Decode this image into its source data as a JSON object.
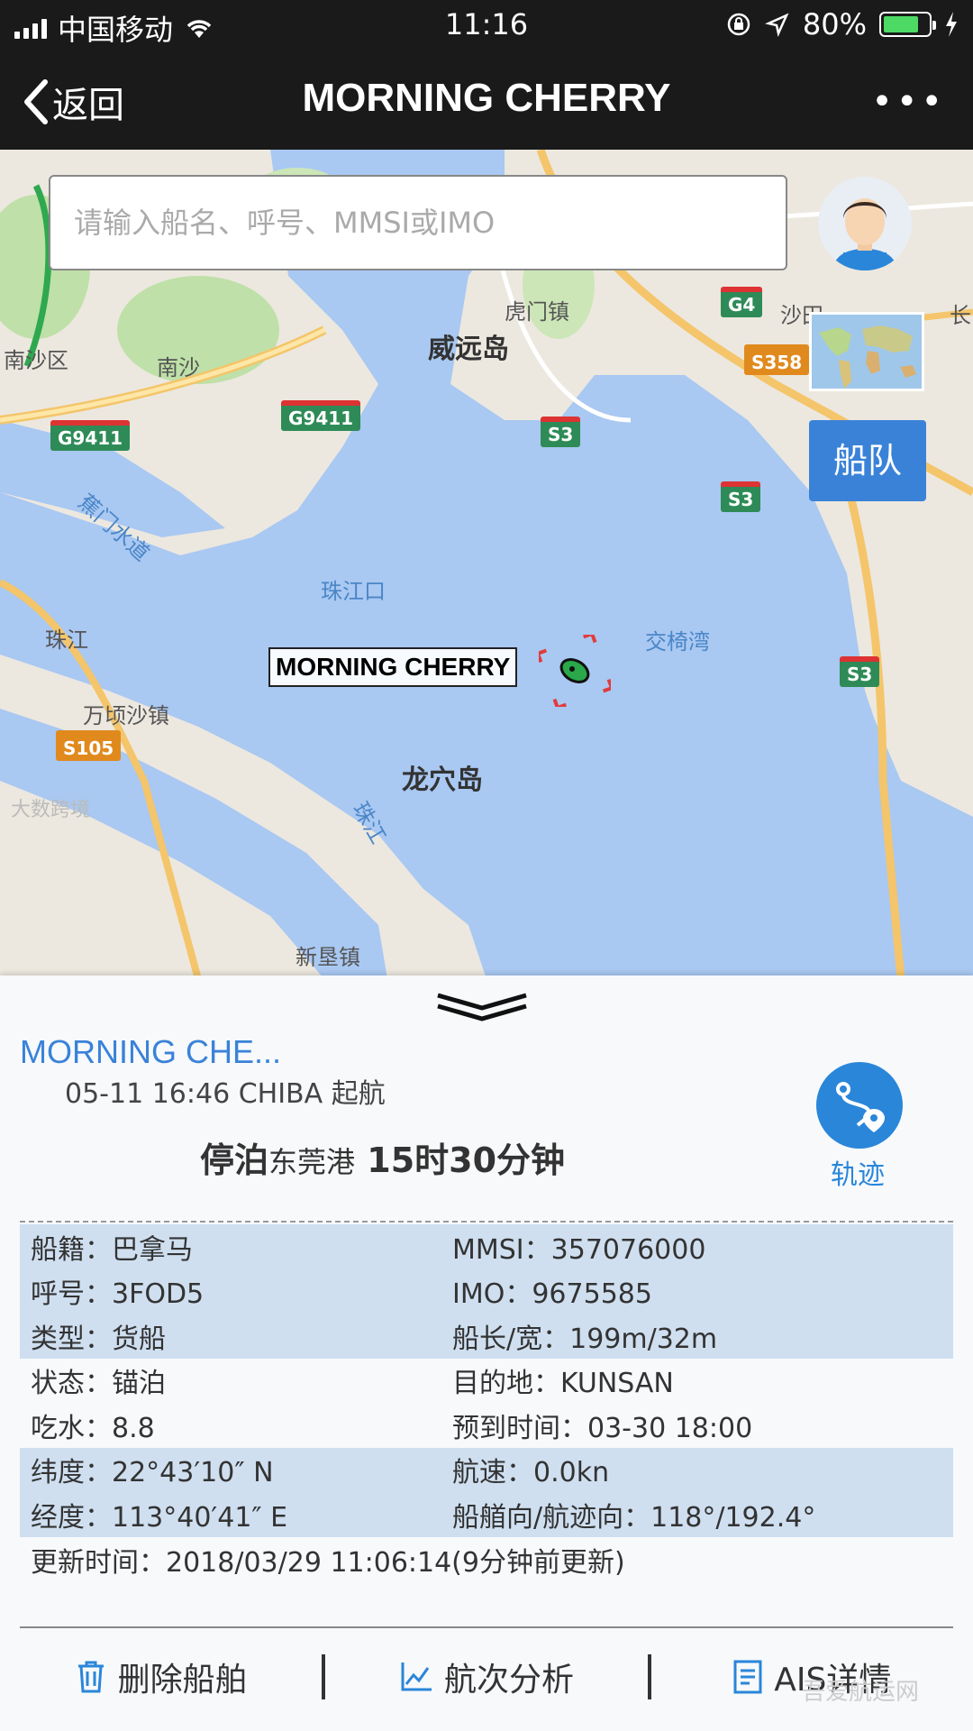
{
  "status_bar": {
    "carrier": "中国移动",
    "time": "11:16",
    "battery": "80%",
    "battery_level": 0.8
  },
  "nav": {
    "back_label": "返回",
    "title": "MORNING CHERRY",
    "more": "•••"
  },
  "map": {
    "search_placeholder": "请输入船名、呼号、MMSI或IMO",
    "fleet_button": "船队",
    "ship_label": "MORNING CHERRY",
    "labels": {
      "weiyuan": "威远岛",
      "humen": "虎门镇",
      "nansha_district": "南沙区",
      "nansha": "南沙",
      "jiaomen": "蕉门水道",
      "zhujiangkou": "珠江口",
      "jiaoyiwan": "交椅湾",
      "zhujiang1": "珠江",
      "wanqingsha": "万顷沙镇",
      "longxuedao": "龙穴岛",
      "zhujiang2": "珠江",
      "xinken": "新垦镇",
      "shatian": "沙田",
      "changan": "长"
    },
    "shields": {
      "g9411_a": "G9411",
      "g9411_b": "G9411",
      "s3_a": "S3",
      "s3_b": "S3",
      "s3_c": "S3",
      "g4": "G4",
      "s358": "S358",
      "s105": "S105"
    }
  },
  "panel": {
    "ship_name": "MORNING CHE...",
    "voyage_line": "05-11 16:46 CHIBA 起航",
    "status_prefix": "停泊",
    "status_port": "东莞港",
    "status_duration": "15时30分钟",
    "track_label": "轨迹",
    "rows": [
      {
        "c1": "船籍：巴拿马",
        "c2": "MMSI：357076000"
      },
      {
        "c1": "呼号：3FOD5",
        "c2": "IMO：9675585"
      },
      {
        "c1": "类型：货船",
        "c2": "船长/宽：199m/32m"
      },
      {
        "c1": "状态：锚泊",
        "c2": "目的地：KUNSAN"
      },
      {
        "c1": "吃水：8.8",
        "c2": "预到时间：03-30 18:00"
      },
      {
        "c1": "纬度：22°43′10″ N",
        "c2": "航速：0.0kn"
      },
      {
        "c1": "经度：113°40′41″ E",
        "c2": "船艏向/航迹向：118°/192.4°"
      }
    ],
    "update_line": "更新时间：2018/03/29 11:06:14(9分钟前更新)",
    "toolbar": {
      "delete": "删除船舶",
      "voyage_analysis": "航次分析",
      "ais_detail": "AIS详情"
    }
  },
  "watermarks": {
    "left": "大数跨境",
    "right": "吾爱航运网"
  },
  "colors": {
    "accent": "#3a82d8",
    "nav_bg": "#1a1a1a",
    "water": "#a9c8f2",
    "land": "#ece8df",
    "ship_green": "#2aa84a"
  },
  "icons": {
    "back": "chevron-left-icon",
    "more": "ellipsis-icon",
    "track": "route-icon",
    "delete": "trash-icon",
    "analysis": "line-chart-icon",
    "ais": "document-icon"
  }
}
